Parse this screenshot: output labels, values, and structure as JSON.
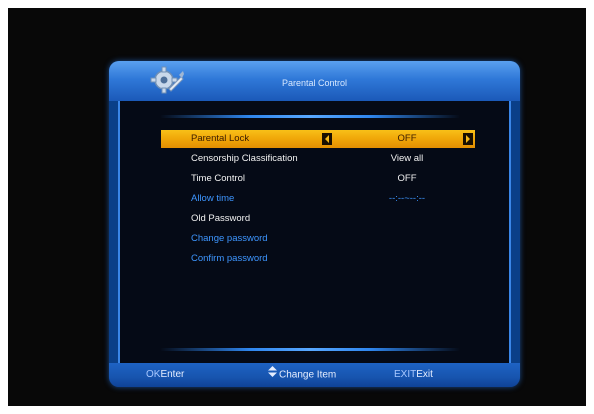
{
  "dialog": {
    "title": "Parental Control",
    "icon": "gear-icon"
  },
  "menu": [
    {
      "label": "Parental Lock",
      "value": "OFF",
      "selected": true
    },
    {
      "label": "Censorship Classification",
      "value": "View all"
    },
    {
      "label": "Time Control",
      "value": "OFF"
    },
    {
      "label": "Allow time",
      "value": "--:--~--:--"
    },
    {
      "label": "Old Password",
      "value": ""
    },
    {
      "label": "Change password",
      "value": ""
    },
    {
      "label": "Confirm password",
      "value": ""
    }
  ],
  "footer": {
    "ok_key": "OK",
    "ok_label": "Enter",
    "updown_label": "Change Item",
    "exit_key": "EXIT",
    "exit_label": "Exit"
  },
  "colors": {
    "highlight": "#f0a608",
    "accent_blue": "#3e96ff",
    "frame_blue": "#2f78d8"
  }
}
